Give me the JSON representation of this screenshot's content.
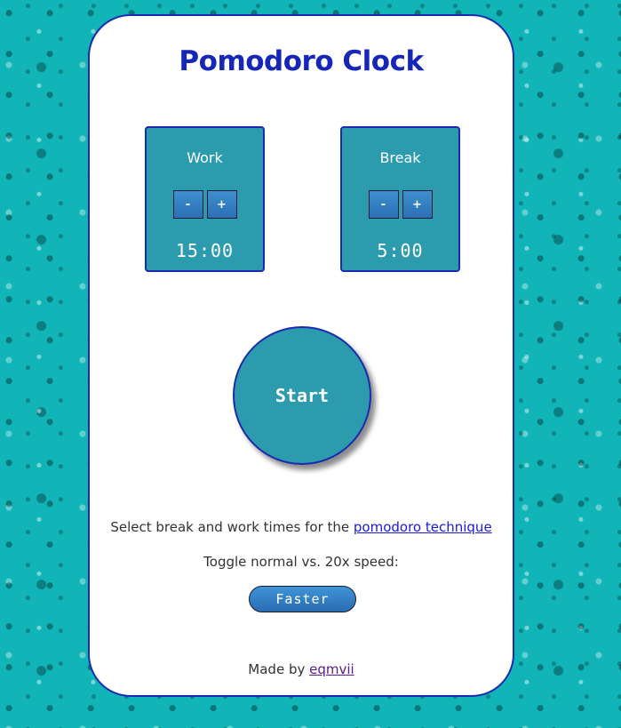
{
  "title": "Pomodoro Clock",
  "work": {
    "label": "Work",
    "decrement_label": "-",
    "increment_label": "+",
    "value": "15:00"
  },
  "break": {
    "label": "Break",
    "decrement_label": "-",
    "increment_label": "+",
    "value": "5:00"
  },
  "start_label": "Start",
  "info": {
    "text": "Select break and work times for the ",
    "link_text": "pomodoro technique"
  },
  "toggle": {
    "label": "Toggle normal vs. 20x speed:",
    "button_label": "Faster"
  },
  "footer": {
    "text": "Made by ",
    "link_text": "eqmvii"
  },
  "colors": {
    "background": "#11b5b8",
    "title": "#1627b8",
    "panel": "#2d9bae",
    "border": "#1a2bb0",
    "button": "#3d8fd0"
  }
}
